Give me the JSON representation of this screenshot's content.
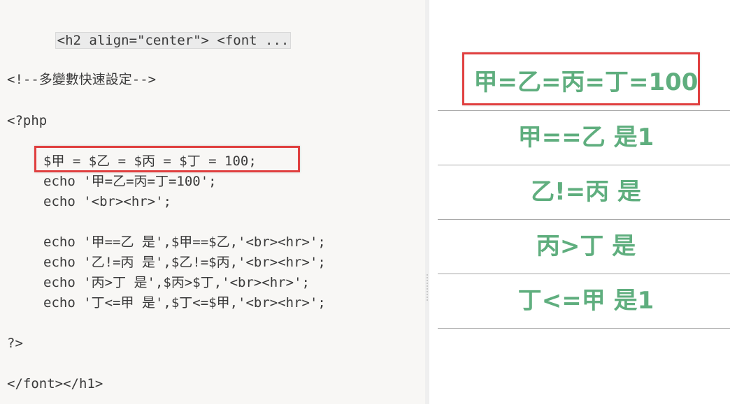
{
  "editor": {
    "lines": [
      "<h2 align=\"center\"> <font ...",
      "<!--多變數快速設定-->",
      "<?php",
      "$甲 = $乙 = $丙 = $丁 = 100;",
      "echo '甲=乙=丙=丁=100';",
      "echo '<br><hr>';",
      "echo '甲==乙 是',$甲==$乙,'<br><hr>';",
      "echo '乙!=丙 是',$乙!=$丙,'<br><hr>';",
      "echo '丙>丁 是',$丙>$丁,'<br><hr>';",
      "echo '丁<=甲 是',$丁<=$甲,'<br><hr>';",
      "?>",
      "</font></h1>"
    ]
  },
  "preview": {
    "outputs": [
      "甲=乙=丙=丁=100",
      "甲==乙 是1",
      "乙!=丙 是",
      "丙>丁 是",
      "丁<=甲 是1"
    ]
  },
  "colors": {
    "output_text": "#5fae7e",
    "highlight_box": "#e04040",
    "editor_bg": "#f8f7f5"
  }
}
